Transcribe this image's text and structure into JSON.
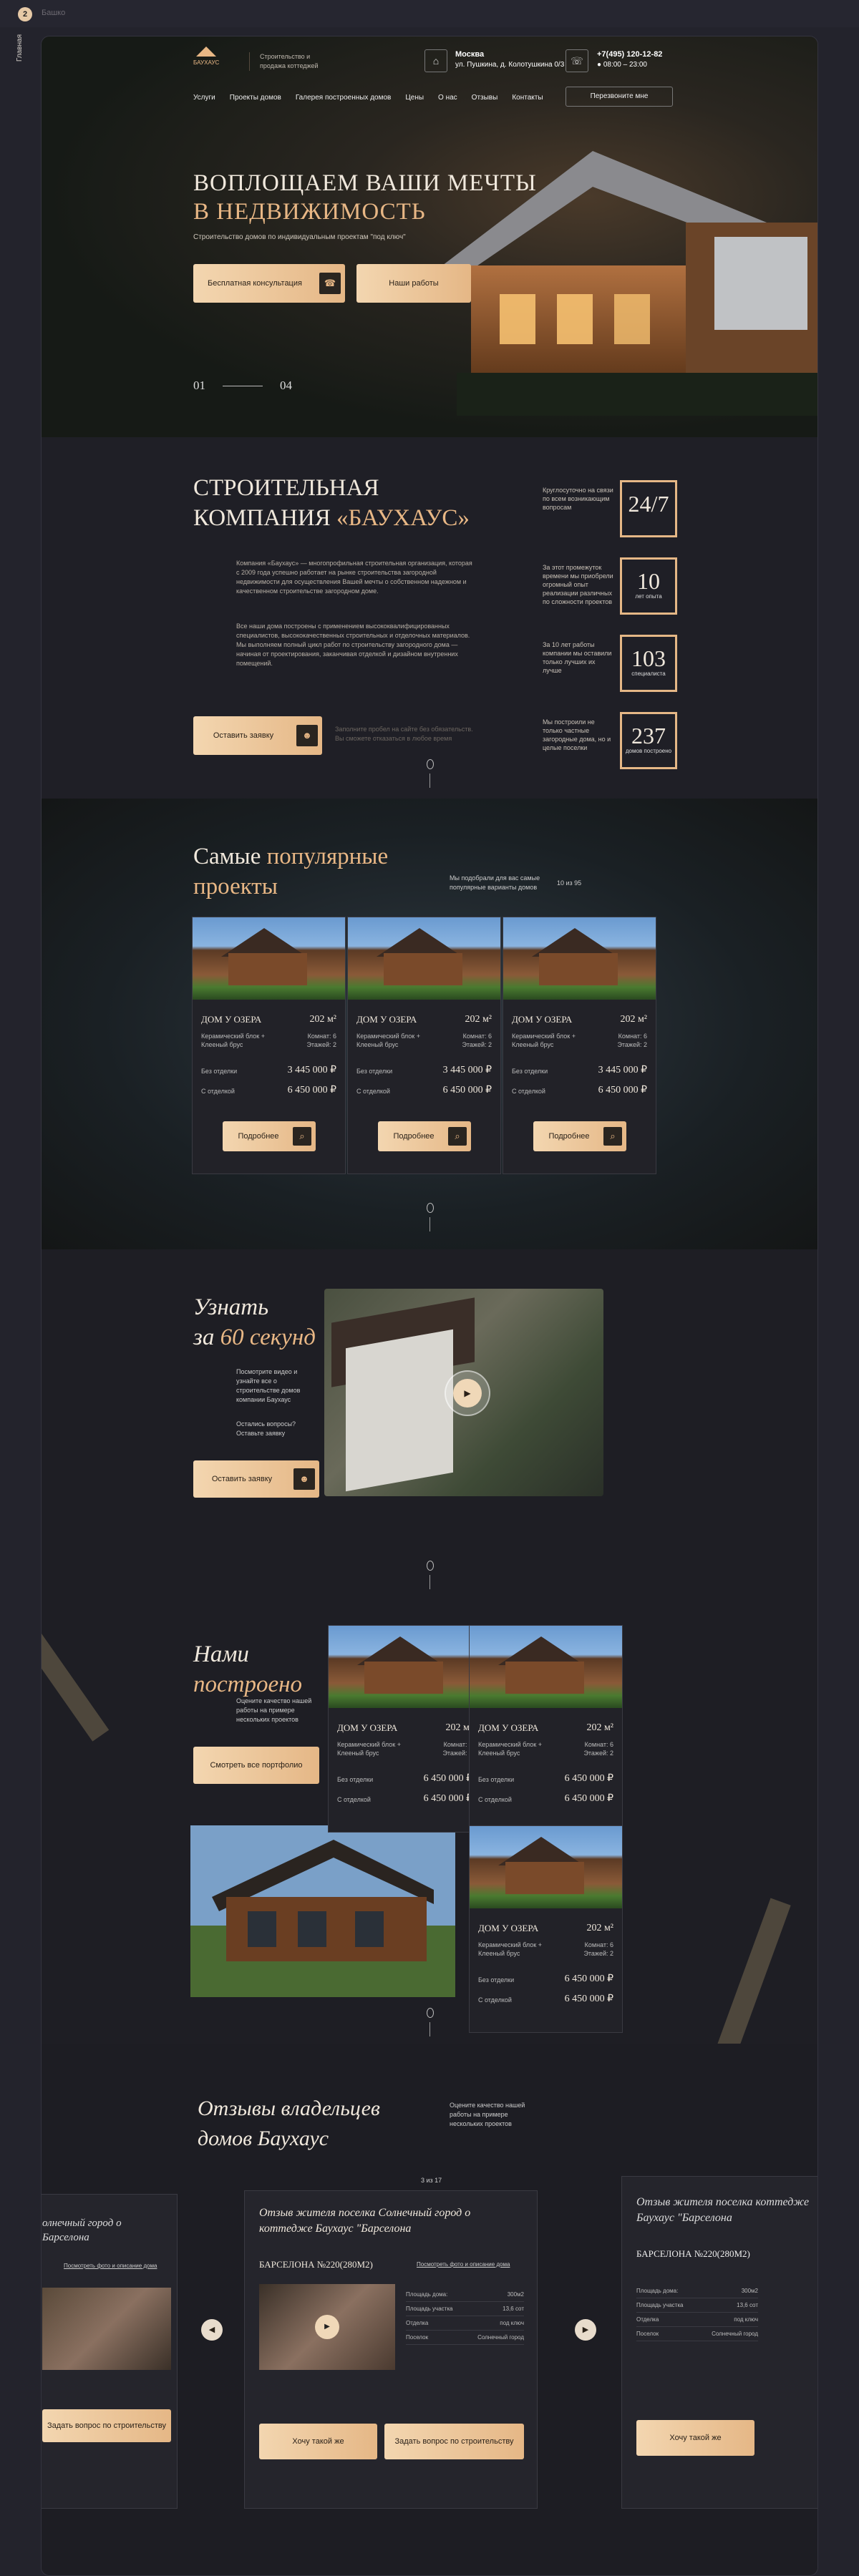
{
  "frame": {
    "icon": "2",
    "label": "Бaшко",
    "side": "Главная"
  },
  "header": {
    "tagline": "Строительство и продажа коттеджей",
    "city": "Москва",
    "address": "ул. Пушкина, д. Колотушкина 0/3",
    "phone": "+7(495) 120-12-82",
    "hours": "● 08:00 – 23:00",
    "callback": "Перезвоните мне",
    "nav": [
      "Услуги",
      "Проекты домов",
      "Галерея построенных домов",
      "Цены",
      "О нас",
      "Отзывы",
      "Контакты"
    ]
  },
  "hero": {
    "title1": "ВОПЛОЩАЕМ ВАШИ МЕЧТЫ",
    "title2": "В НЕДВИЖИМОСТЬ",
    "sub": "Строительство домов по индивидуальным проектам \"под ключ\"",
    "btn1": "Бесплатная консультация",
    "btn2": "Наши работы",
    "slide_cur": "01",
    "slide_total": "04"
  },
  "about": {
    "title1": "СТРОИТЕЛЬНАЯ",
    "title2a": "КОМПАНИЯ ",
    "title2b": "«БАУХАУС»",
    "p1": "Компания «Баухаус» — многопрофильная строительная организация, которая с 2009 года успешно работает на рынке строительства загородной недвижимости для осуществления Вашей мечты о собственном надежном и качественном строительстве загородном доме.",
    "p2": "Все наши дома построены с применением высококвалифицированных специалистов, высококачественных строительных и отделочных материалов. Мы выполняем полный цикл работ по строительству загородного дома — начиная от проектирования, заканчивая отделкой и дизайном внутренних помещений.",
    "btn": "Оставить заявку",
    "note": "Заполните пробел на сайте без обязательств. Вы сможете отказаться в любое время",
    "stats": [
      {
        "text": "Круглосуточно на связи по всем возникающим вопросам",
        "num": "24/7",
        "unit": ""
      },
      {
        "text": "За этот промежуток времени мы приобрели огромный опыт реализации различных по сложности проектов",
        "num": "10",
        "unit": "лет опыта"
      },
      {
        "text": "За 10 лет работы компании мы оставили только лучших их лучше",
        "num": "103",
        "unit": "специалиста"
      },
      {
        "text": "Мы построили не только частные загородные дома, но и целые поселки",
        "num": "237",
        "unit": "домов построено"
      }
    ]
  },
  "projects": {
    "title1": "Самые ",
    "title1b": "популярные",
    "title2": "проекты",
    "desc": "Мы подобрали для вас самые популярные варианты домов",
    "pager": "10 из 95",
    "cards": [
      {
        "name": "ДОМ У ОЗЕРА",
        "area": "202 м²",
        "mat": "Керамический блок + Клееный брус",
        "rooms": "Комнат: 6",
        "floors": "Этажей: 2",
        "p1l": "Без отделки",
        "p1": "3 445 000 ₽",
        "p2l": "С отделкой",
        "p2": "6 450 000 ₽",
        "btn": "Подробнее"
      },
      {
        "name": "ДОМ У ОЗЕРА",
        "area": "202 м²",
        "mat": "Керамический блок + Клееный брус",
        "rooms": "Комнат: 6",
        "floors": "Этажей: 2",
        "p1l": "Без отделки",
        "p1": "3 445 000 ₽",
        "p2l": "С отделкой",
        "p2": "6 450 000 ₽",
        "btn": "Подробнее"
      },
      {
        "name": "ДОМ У ОЗЕРА",
        "area": "202 м²",
        "mat": "Керамический блок + Клееный брус",
        "rooms": "Комнат: 6",
        "floors": "Этажей: 2",
        "p1l": "Без отделки",
        "p1": "3 445 000 ₽",
        "p2l": "С отделкой",
        "p2": "6 450 000 ₽",
        "btn": "Подробнее"
      }
    ]
  },
  "video": {
    "title1": "Узнать",
    "title2a": "за ",
    "title2b": "60 секунд",
    "desc": "Посмотрите видео и узнайте все о строительстве домов компании Баухаус",
    "q": "Остались вопросы? Оставьте заявку",
    "btn": "Оставить заявку"
  },
  "built": {
    "title1": "Нами",
    "title2": "построено",
    "desc": "Оцените качество нашей работы на примере нескольких проектов",
    "btn": "Смотреть все портфолио",
    "cards": [
      {
        "name": "ДОМ У ОЗЕРА",
        "area": "202 м²",
        "mat": "Керамический блок + Клееный брус",
        "rooms": "Комнат: 6",
        "floors": "Этажей: 2",
        "p1l": "Без отделки",
        "p1": "6 450 000 ₽",
        "p2l": "С отделкой",
        "p2": "6 450 000 ₽"
      },
      {
        "name": "ДОМ У ОЗЕРА",
        "area": "202 м²",
        "mat": "Керамический блок + Клееный брус",
        "rooms": "Комнат: 6",
        "floors": "Этажей: 2",
        "p1l": "Без отделки",
        "p1": "6 450 000 ₽",
        "p2l": "С отделкой",
        "p2": "6 450 000 ₽"
      },
      {
        "name": "ДОМ У ОЗЕРА",
        "area": "202 м²",
        "mat": "Керамический блок + Клееный брус",
        "rooms": "Комнат: 6",
        "floors": "Этажей: 2",
        "p1l": "Без отделки",
        "p1": "6 450 000 ₽",
        "p2l": "С отделкой",
        "p2": "6 450 000 ₽"
      },
      {
        "name": "ДОМ У ОЗЕРА",
        "area": "202 м²",
        "mat": "Керамический блок + Клееный брус",
        "rooms": "Комнат: 6",
        "floors": "Этажей: 2",
        "p1l": "Без отделки",
        "p1": "6 450 000 ₽",
        "p2l": "С отделкой",
        "p2": "6 450 000 ₽"
      }
    ]
  },
  "reviews": {
    "title1": "Отзывы владельцев",
    "title2": "домов Баухаус",
    "desc": "Оцените качество нашей работы на примере нескольких проектов",
    "pager": "3 из 17",
    "main": {
      "title": "Отзыв жителя поселка Солнечный город о коттедже Баухаус \"Барселона",
      "sub": "БАРСЕЛОНА №220(280М2)",
      "link": "Посмотреть фото и описание дома",
      "specs": [
        [
          "Площадь дома:",
          "300м2"
        ],
        [
          "Площадь участка",
          "13,6 сот"
        ],
        [
          "Отделка",
          "под ключ"
        ],
        [
          "Поселок",
          "Солнечный город"
        ]
      ],
      "btn1": "Хочу такой же",
      "btn2": "Задать вопрос по строительству"
    },
    "left": {
      "title": "олнечный город о Барселона",
      "link": "Посмотреть фото и описание дома",
      "btn": "Задать вопрос по строительству"
    },
    "right": {
      "title": "Отзыв жителя поселка коттедже Баухаус \"Барселона",
      "sub": "БАРСЕЛОНА №220(280М2)",
      "specs": [
        [
          "Площадь дома:",
          "300м2"
        ],
        [
          "Площадь участка",
          "13,6 сот"
        ],
        [
          "Отделка",
          "под ключ"
        ],
        [
          "Поселок",
          "Солнечный город"
        ]
      ],
      "btn": "Хочу такой же"
    }
  },
  "colors": {
    "accent": "#e5b786",
    "bg": "#1f1f26"
  }
}
